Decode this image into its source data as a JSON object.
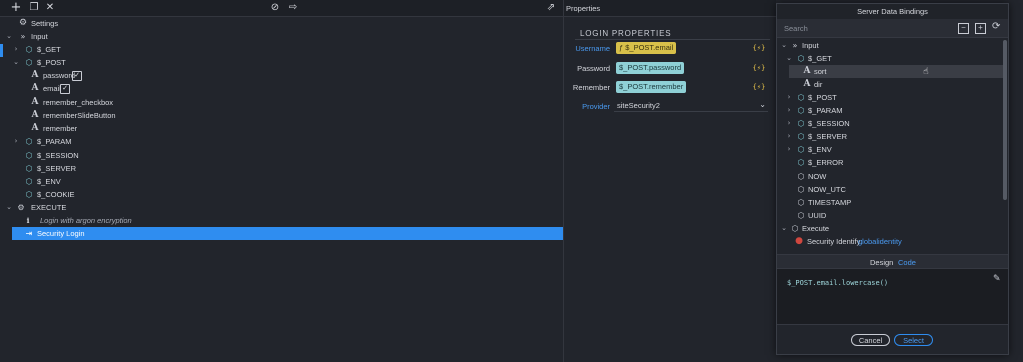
{
  "toolbar": {
    "icons": [
      "plus-icon",
      "copy-icon",
      "close-icon",
      "disable-icon",
      "export-icon",
      "share-icon"
    ]
  },
  "tree": {
    "settings": "Settings",
    "input": "Input",
    "get": "$_GET",
    "post": "$_POST",
    "post_items": [
      "password",
      "email",
      "remember_checkbox",
      "rememberSlideButton",
      "remember"
    ],
    "param": "$_PARAM",
    "session": "$_SESSION",
    "server": "$_SERVER",
    "env": "$_ENV",
    "cookie": "$_COOKIE",
    "execute": "EXECUTE",
    "comment": "Login with argon encryption",
    "security_login": "Security Login"
  },
  "properties": {
    "header": "Properties",
    "section_title": "LOGIN PROPERTIES",
    "username_label": "Username",
    "username_value": "ƒ $_POST.email",
    "password_label": "Password",
    "password_value": "$_POST.password",
    "remember_label": "Remember",
    "remember_value": "$_POST.remember",
    "provider_label": "Provider",
    "provider_value": "siteSecurity2",
    "dynamic_glyph": "{⚡}"
  },
  "dialog": {
    "title": "Server Data Bindings",
    "search_placeholder": "Search",
    "tree": {
      "input": "Input",
      "get": "$_GET",
      "sort": "sort",
      "dir": "dir",
      "post": "$_POST",
      "param": "$_PARAM",
      "session": "$_SESSION",
      "server": "$_SERVER",
      "env": "$_ENV",
      "error": "$_ERROR",
      "now": "NOW",
      "now_utc": "NOW_UTC",
      "timestamp": "TIMESTAMP",
      "uuid": "UUID",
      "execute": "Execute",
      "identify": "Security Identify:",
      "identify_value": "globalidentity"
    },
    "tabs": {
      "design": "Design",
      "code": "Code"
    },
    "code_text": "$_POST.email.lowercase()",
    "cancel": "Cancel",
    "select": "Select"
  },
  "colors": {
    "accent": "#2f8df0",
    "yellow_chip": "#d8c04a",
    "teal_chip": "#8fd0d6"
  }
}
